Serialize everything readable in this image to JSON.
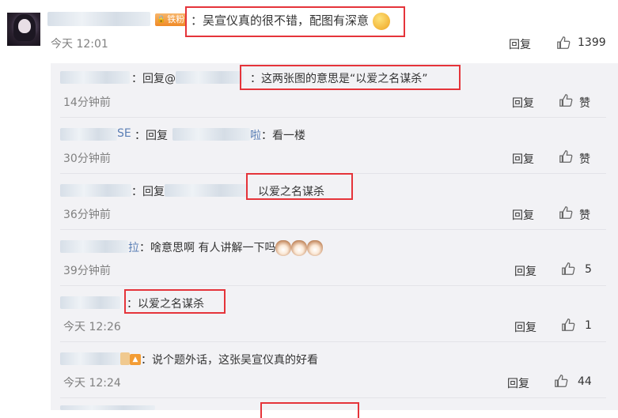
{
  "main_comment": {
    "badge": "铁粉",
    "text": "：吴宣仪真的很不错，配图有深意",
    "time": "今天 12:01",
    "reply_label": "回复",
    "like_count": "1399"
  },
  "replies": [
    {
      "prefix": "：回复@",
      "text": "：这两张图的意思是“以爱之名谋杀”",
      "time": "14分钟前",
      "reply_label": "回复",
      "like": "赞"
    },
    {
      "user_suffix": "SE",
      "prefix": "：回复",
      "mention_suffix": "啦",
      "text": "：看一楼",
      "time": "30分钟前",
      "reply_label": "回复",
      "like": "赞"
    },
    {
      "prefix": "：回复",
      "text": "以爱之名谋杀",
      "time": "36分钟前",
      "reply_label": "回复",
      "like": "赞"
    },
    {
      "user_suffix": "拉",
      "text": "：啥意思啊 有人讲解一下吗",
      "time": "39分钟前",
      "reply_label": "回复",
      "like": "5"
    },
    {
      "text": "：以爱之名谋杀",
      "time": "今天 12:26",
      "reply_label": "回复",
      "like": "1"
    },
    {
      "text": "：说个题外话，这张吴宣仪真的好看",
      "time": "今天 12:24",
      "reply_label": "回复",
      "like": "44"
    }
  ],
  "colors": {
    "highlight_box": "#e5343a",
    "reply_bg": "#f2f2f5",
    "accent": "#eb7350"
  },
  "icons": {
    "like": "thumbs-up-icon",
    "emoji": "smile-emoji-icon",
    "cat": "cat-emoji-icon"
  }
}
